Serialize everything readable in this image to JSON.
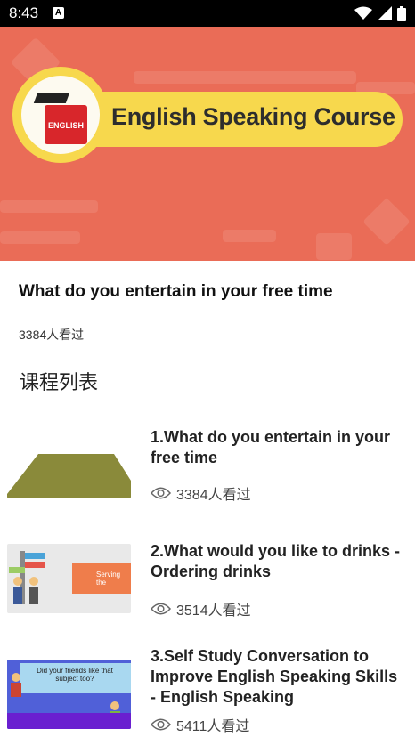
{
  "status_bar": {
    "time": "8:43",
    "notification_badge": "A"
  },
  "banner": {
    "title": "English Speaking Course",
    "logo_text": "ENGLISH",
    "bg_color": "#ea6c57",
    "pill_color": "#f7d84d"
  },
  "course": {
    "title": "What do you entertain in your free time",
    "views": "3384人看过"
  },
  "section_title": "课程列表",
  "lessons": [
    {
      "title": "1.What do you entertain in your free time",
      "views": "3384人看过"
    },
    {
      "title": "2.What would you like to drinks - Ordering drinks",
      "views": "3514人看过",
      "thumb_text": "Serving the"
    },
    {
      "title": "3.Self Study Conversation to Improve English Speaking Skills - English Speaking",
      "views": "5411人看过",
      "thumb_text": "Did your friends like that subject too?"
    }
  ]
}
